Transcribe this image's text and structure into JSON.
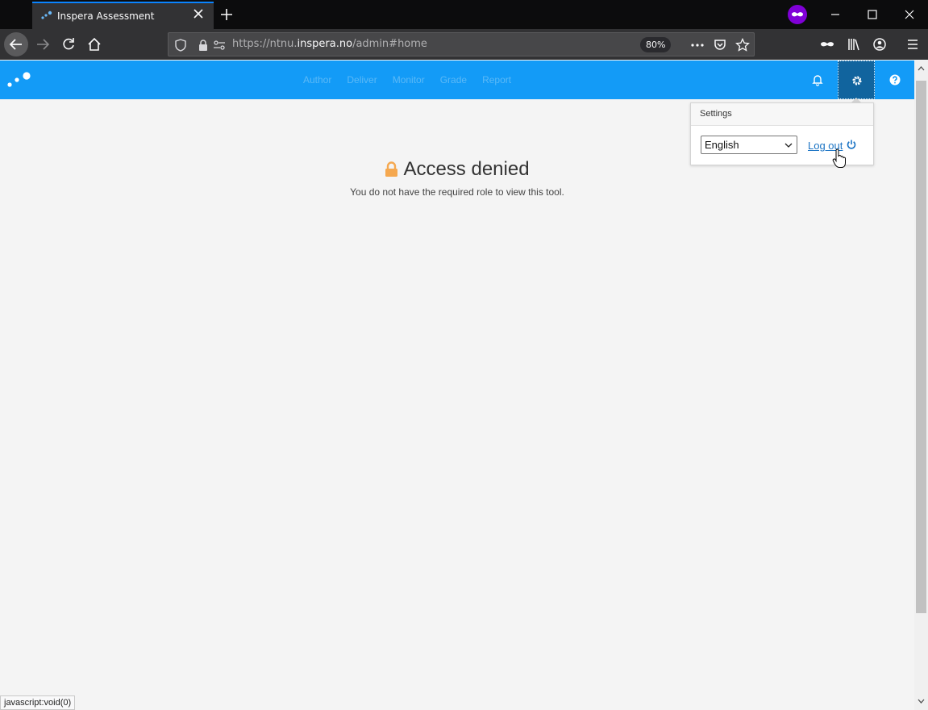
{
  "browser": {
    "tab_title": "Inspera Assessment",
    "url_prefix": "https://ntnu.",
    "url_domain": "inspera.no",
    "url_path": "/admin#home",
    "zoom": "80%",
    "status_url": "javascript:void(0)"
  },
  "header": {
    "nav": [
      "Author",
      "Deliver",
      "Monitor",
      "Grade",
      "Report"
    ]
  },
  "settings": {
    "title": "Settings",
    "language_selected": "English",
    "logout_label": "Log out"
  },
  "main": {
    "title": "Access denied",
    "message": "You do not have the required role to view this tool."
  },
  "colors": {
    "header_bg": "#139bf7",
    "lock": "#f5a84f",
    "link": "#1a73c4"
  }
}
